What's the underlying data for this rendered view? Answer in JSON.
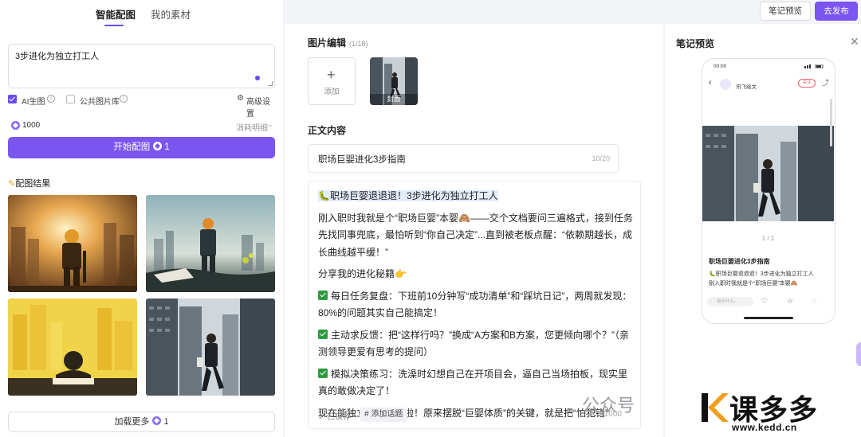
{
  "left": {
    "tabs": [
      "智能配图",
      "我的素材"
    ],
    "prompt": "3步进化为独立打工人",
    "options": {
      "ai": "AI生图",
      "public": "公共图片库",
      "advanced": "高级设置"
    },
    "credits": "1000",
    "cost_detail": "消耗明细",
    "start": {
      "label": "开始配图",
      "cost": "1"
    },
    "results_title": "配图结果",
    "load_more": {
      "label": "加载更多",
      "cost": "1"
    }
  },
  "topbar": {
    "preview": "笔记预览",
    "publish": "去发布"
  },
  "editor": {
    "images_title": "图片编辑",
    "images_count": "(1/18)",
    "add_label": "添加",
    "cover_label": "封面",
    "content_title": "正文内容",
    "title_value": "职场巨婴进化3步指南",
    "title_count": "10/20",
    "body": {
      "heading": "🐛职场巨婴退退退！3步进化为独立打工人",
      "p1": "刚入职时我就是个“职场巨婴”本婴🙈——交个文档要问三遍格式，接到任务先找同事兜底，最怕听到“你自己决定”...直到被老板点醒：“依赖期越长，成长曲线越平缓！”",
      "p2": "分享我的进化秘籍👉",
      "item1": "每日任务复盘：下班前10分钟写“成功清单”和“踩坑日记”，两周就发现：80%的问题其实自己能搞定！",
      "item2": "主动求反馈：把“这样行吗？”换成“A方案和B方案，您更倾向哪个？”（亲测领导更爱有思考的提问）",
      "item3": "模拟决策练习：洗澡时幻想自己在开项目会，逼自己当场拍板，现实里真的敢做决定了！",
      "p3": "现在能独立带小项目啦！原来摆脱“巨婴体质”的关键，就是把“怕犯错”"
    },
    "saved": "已保存",
    "topic": "# 添加话题",
    "char_count": "344/1000"
  },
  "preview": {
    "title": "笔记预览",
    "time": "00:00",
    "author": "讯飞绘文",
    "follow": "关注",
    "page": "1 / 1",
    "note_title": "职场巨婴进化3步指南",
    "line1": "🐛职场巨婴退退退！3步进化为独立打工人",
    "line2": "刚入职时我就是个“职场巨婴”本婴🙈",
    "comment_placeholder": "说点什么..."
  },
  "watermark": {
    "gzh": "公众号",
    "logo": "课多多",
    "url": "www.kedd.cn"
  }
}
